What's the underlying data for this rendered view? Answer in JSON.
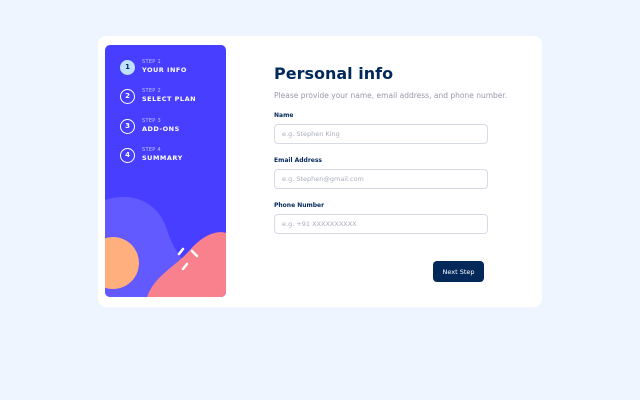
{
  "colors": {
    "sidebar": "#483eff",
    "primary": "#02295a",
    "active_step": "#bee2fd",
    "page_bg": "#eef5fe",
    "muted": "#9699ab",
    "border": "#d6d9e6",
    "shape_orange": "#ffaf7e",
    "shape_pink": "#f9818e",
    "shape_blue": "#6259ff"
  },
  "steps": [
    {
      "number": "1",
      "label": "STEP 1",
      "title": "YOUR INFO",
      "active": true
    },
    {
      "number": "2",
      "label": "STEP 2",
      "title": "SELECT PLAN",
      "active": false
    },
    {
      "number": "3",
      "label": "STEP 3",
      "title": "ADD-ONS",
      "active": false
    },
    {
      "number": "4",
      "label": "STEP 4",
      "title": "SUMMARY",
      "active": false
    }
  ],
  "form": {
    "title": "Personal info",
    "subtitle": "Please provide your name, email address, and phone number.",
    "fields": [
      {
        "label": "Name",
        "placeholder": "e.g. Stephen King",
        "value": ""
      },
      {
        "label": "Email Address",
        "placeholder": "e.g. Stephen@gmail.com",
        "value": ""
      },
      {
        "label": "Phone Number",
        "placeholder": "e.g. +91 XXXXXXXXXX",
        "value": ""
      }
    ],
    "next_label": "Next Step"
  }
}
